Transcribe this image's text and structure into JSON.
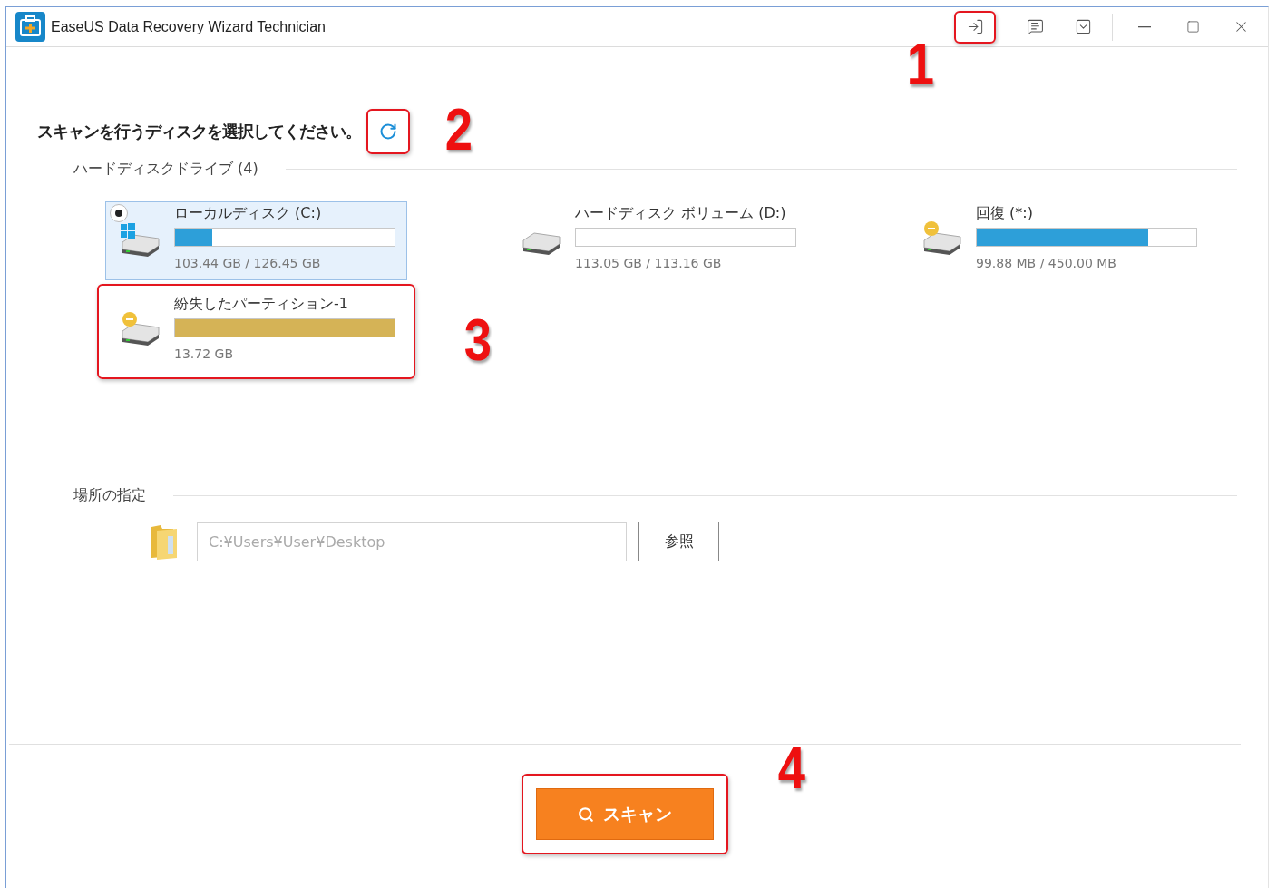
{
  "window": {
    "title": "EaseUS Data Recovery Wizard Technician"
  },
  "title_buttons": [
    {
      "kind": "import"
    },
    {
      "kind": "feedback"
    },
    {
      "kind": "menu"
    },
    {
      "kind": "minimize"
    },
    {
      "kind": "maximize"
    },
    {
      "kind": "close"
    }
  ],
  "heading": "スキャンを行うディスクを選択してください。",
  "drive_group": {
    "label": "ハードディスクドライブ (4)"
  },
  "disks": [
    {
      "kind": "system",
      "name": "ローカルディスク (C:)",
      "size": "103.44 GB / 126.45 GB",
      "level": 0.17,
      "color": "#2d9fd9",
      "selected": true
    },
    {
      "kind": "plain",
      "name": "ハードディスク ボリューム (D:)",
      "size": "113.05 GB / 113.16 GB",
      "selected": false
    },
    {
      "kind": "warning",
      "name": "回復 (*:)",
      "size": "99.88 MB / 450.00 MB",
      "level": 0.78,
      "color": "#2d9fd9",
      "selected": false
    },
    {
      "kind": "warning",
      "name": "紛失したパーティション-1",
      "size": "13.72 GB",
      "color": "#d5b356",
      "selected": false
    }
  ],
  "location": {
    "label": "場所の指定",
    "placeholder": "C:¥Users¥User¥Desktop",
    "browse": "参照"
  },
  "scan_button": {
    "label": "スキャン"
  },
  "annotations": [
    {
      "number": "1"
    },
    {
      "number": "2"
    },
    {
      "number": "3"
    },
    {
      "number": "4"
    }
  ]
}
